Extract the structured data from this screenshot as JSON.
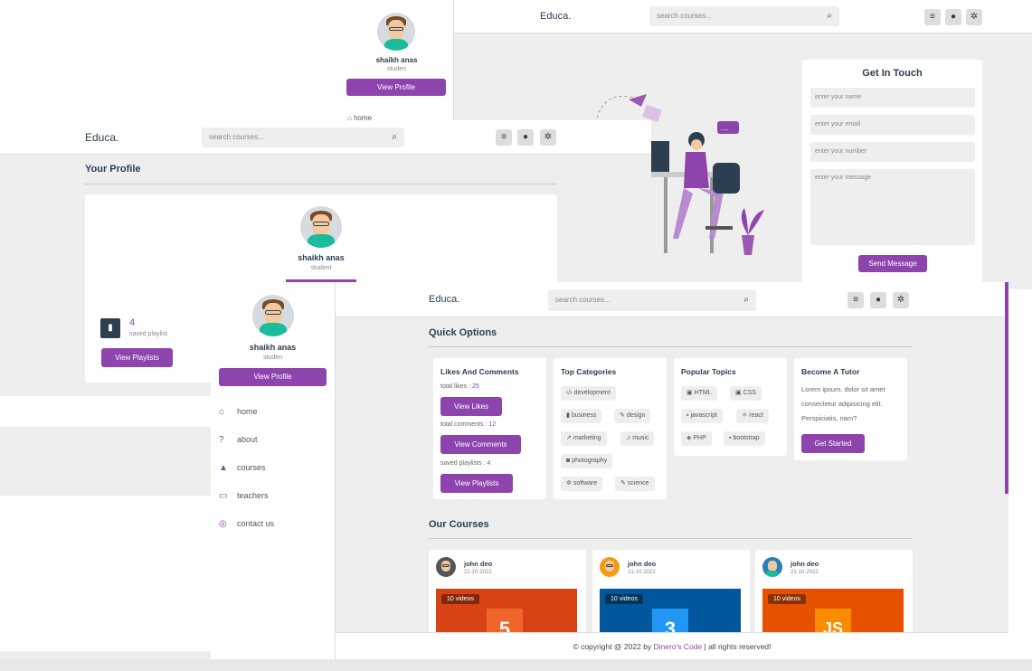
{
  "back_window": {
    "logo": "Educa.",
    "search_placeholder": "search courses...",
    "sidebar_name": "shaikh anas",
    "sidebar_role": "studen",
    "view_profile": "View Profile",
    "sidebar_home": "home",
    "contact": {
      "title": "Get In Touch",
      "name_placeholder": "enter your name",
      "email_placeholder": "enter your email",
      "number_placeholder": "enter your number",
      "message_placeholder": "enter your message",
      "send_button": "Send Message"
    }
  },
  "middle_window": {
    "logo": "Educa.",
    "search_placeholder": "search courses...",
    "heading": "Your Profile",
    "name": "shaikh anas",
    "role": "student",
    "saved_count": "4",
    "saved_label": "saved playlist",
    "view_playlists": "View Playlists"
  },
  "front_window": {
    "logo": "Educa.",
    "search_placeholder": "search courses...",
    "sidebar": {
      "name": "shaikh anas",
      "role": "studen",
      "view_profile": "View Profile",
      "links": [
        {
          "label": "home",
          "icon": "home-icon"
        },
        {
          "label": "about",
          "icon": "question-icon"
        },
        {
          "label": "courses",
          "icon": "graduation-cap-icon"
        },
        {
          "label": "teachers",
          "icon": "teacher-icon"
        },
        {
          "label": "contact us",
          "icon": "headset-icon"
        }
      ]
    },
    "quick_options_title": "Quick Options",
    "likes_box": {
      "title": "Likes And Comments",
      "total_likes_label": "total likes : ",
      "total_likes": "25",
      "view_likes": "View Likes",
      "total_comments_label": "total comments : ",
      "total_comments": "12",
      "view_comments": "View Comments",
      "saved_label": "saved playlists : ",
      "saved": "4",
      "view_playlists": "View Playlists"
    },
    "categories_box": {
      "title": "Top Categories",
      "tags": [
        "development",
        "business",
        "design",
        "marketing",
        "music",
        "photography",
        "software",
        "science"
      ]
    },
    "topics_box": {
      "title": "Popular Topics",
      "tags": [
        "HTML",
        "CSS",
        "javascript",
        "react",
        "PHP",
        "bootstrap"
      ]
    },
    "tutor_box": {
      "title": "Become A Tutor",
      "text": "Lorem ipsum, dolor sit amet consectetur adipisicing elit. Perspiciatis, nam?",
      "button": "Get Started"
    },
    "courses_title": "Our Courses",
    "courses": [
      {
        "author": "john deo",
        "date": "21-10-2022",
        "videos": "10 videos",
        "color": "#d84315",
        "logo": "5"
      },
      {
        "author": "john deo",
        "date": "21-10-2022",
        "videos": "10 videos",
        "color": "#01579b",
        "logo": "3"
      },
      {
        "author": "john deo",
        "date": "21-10-2022",
        "videos": "10 videos",
        "color": "#e65100",
        "logo": "JS"
      }
    ],
    "footer_prefix": "© copyright @ 2022 by ",
    "footer_brand": "Dinero's Code",
    "footer_suffix": " | all rights reserved!"
  },
  "colors": {
    "accent": "#8e44ad",
    "bg": "#eeeeee",
    "text": "#2c3e50"
  }
}
